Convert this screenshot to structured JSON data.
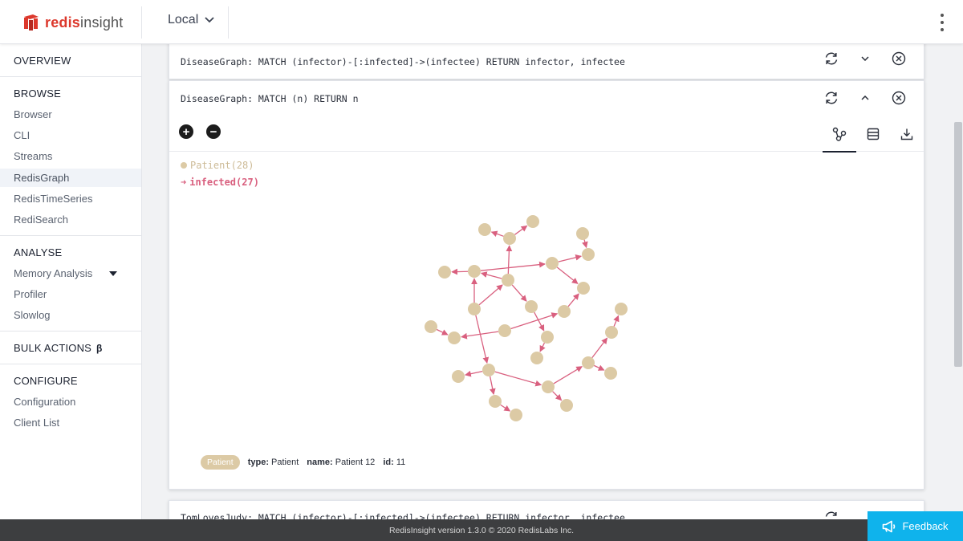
{
  "brand": {
    "name_bold": "redis",
    "name_light": "insight",
    "accent": "#dc382c"
  },
  "header": {
    "db_label": "Local",
    "db_icon": "chevron-down-icon",
    "menu_icon": "kebab-menu-icon"
  },
  "sidebar": {
    "overview": "OVERVIEW",
    "browse": {
      "title": "BROWSE",
      "items": [
        "Browser",
        "CLI",
        "Streams",
        "RedisGraph",
        "RedisTimeSeries",
        "RediSearch"
      ],
      "selected": "RedisGraph"
    },
    "analyse": {
      "title": "ANALYSE",
      "items": [
        "Memory Analysis",
        "Profiler",
        "Slowlog"
      ]
    },
    "bulk": {
      "title": "BULK ACTIONS",
      "badge": "β"
    },
    "configure": {
      "title": "CONFIGURE",
      "items": [
        "Configuration",
        "Client List"
      ]
    }
  },
  "cards": {
    "first": {
      "query": "DiseaseGraph: MATCH (infector)-[:infected]->(infectee) RETURN infector, infectee"
    },
    "main": {
      "query": "DiseaseGraph: MATCH (n) RETURN n",
      "legend": {
        "node_label": "Patient(28)",
        "rel_arrow": "➜",
        "rel_label": "infected(27)"
      },
      "selected": {
        "chip": "Patient",
        "type_key": "type:",
        "type_val": "Patient",
        "name_key": "name:",
        "name_val": "Patient 12",
        "id_key": "id:",
        "id_val": "11"
      }
    },
    "third": {
      "query": "TomLovesJudy: MATCH (infector)-[:infected]->(infectee) RETURN infector, infectee"
    }
  },
  "colors": {
    "node": "#dccaa5",
    "edge": "#d9607f",
    "footer_bg": "#3d3e40",
    "feedback_bg": "#0fb3ec"
  },
  "footer": {
    "text": "RedisInsight version 1.3.0 © 2020 RedisLabs Inc."
  },
  "feedback": {
    "label": "Feedback",
    "icon": "megaphone-icon"
  }
}
